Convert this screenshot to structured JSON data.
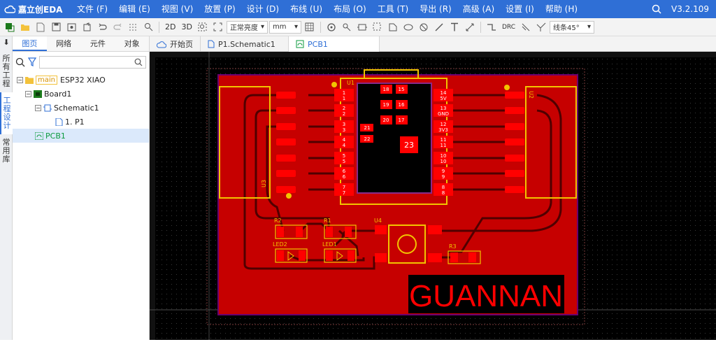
{
  "app": {
    "logo_text": "嘉立创EDA",
    "version": "V3.2.109"
  },
  "menu": [
    "文件 (F)",
    "编辑 (E)",
    "视图 (V)",
    "放置 (P)",
    "设计 (D)",
    "布线 (U)",
    "布局 (O)",
    "工具 (T)",
    "导出 (R)",
    "高级 (A)",
    "设置 (I)",
    "帮助 (H)"
  ],
  "toolbar": {
    "view_2d": "2D",
    "view_3d": "3D",
    "brightness": "正常亮度",
    "unit": "mm",
    "drc": "DRC",
    "track_angle": "线条45°"
  },
  "left_rail": [
    "所有工程",
    "工程设计",
    "常用库"
  ],
  "panel": {
    "tabs": [
      "图页",
      "网络",
      "元件",
      "对象"
    ],
    "tree": [
      {
        "label": "main",
        "name": "ESP32 XIAO"
      },
      {
        "label": "Board1"
      },
      {
        "label": "Schematic1"
      },
      {
        "label": "1. P1"
      },
      {
        "label": "PCB1"
      }
    ]
  },
  "doc_tabs": [
    "开始页",
    "P1.Schematic1",
    "PCB1"
  ],
  "pcb": {
    "board_text": "GUANNAN",
    "ref_u1": "U1",
    "ref_u2": "U2",
    "ref_u3": "U3",
    "ref_u4": "U4",
    "ref_r1": "R1",
    "ref_r2": "R2",
    "ref_r3": "R3",
    "ref_led1": "LED1",
    "ref_led2": "LED2",
    "left_pins": [
      "1",
      "2",
      "3",
      "4",
      "5",
      "6",
      "7"
    ],
    "left_labels": [
      "1",
      "2",
      "3",
      "4",
      "5",
      "6",
      "7"
    ],
    "right_pins": [
      "14",
      "13",
      "12",
      "11",
      "10",
      "9",
      "8"
    ],
    "right_labels": [
      "5V",
      "GND",
      "3V3",
      "11",
      "10",
      "9",
      "8"
    ],
    "center_pads": [
      "18",
      "15",
      "19",
      "16",
      "20",
      "17"
    ],
    "side_pads": [
      "21",
      "22"
    ],
    "big_pad": "23"
  },
  "colors": {
    "menubar": "#2f6fd6",
    "board": "#c60000",
    "pad": "#ff0000",
    "silk": "#f2c400",
    "canvas": "#000000"
  }
}
